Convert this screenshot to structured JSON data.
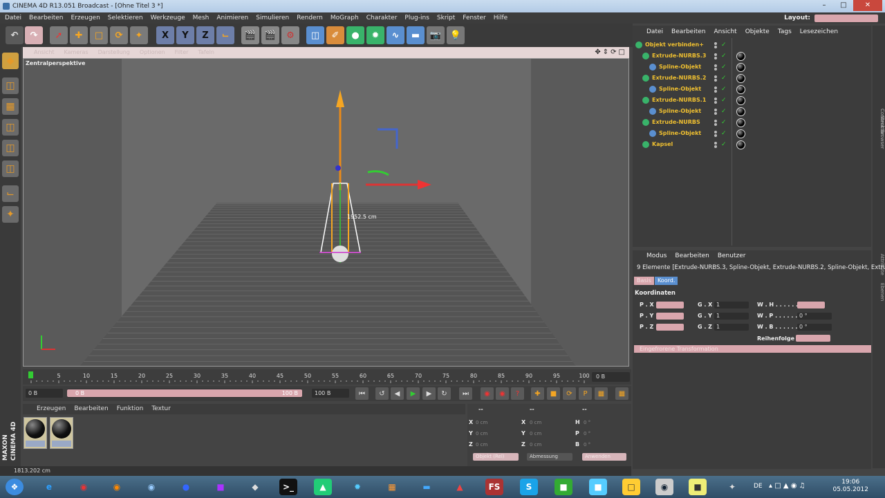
{
  "window": {
    "title": "CINEMA 4D R13.051 Broadcast - [Ohne Titel 3 *]"
  },
  "menubar": [
    "Datei",
    "Bearbeiten",
    "Erzeugen",
    "Selektieren",
    "Werkzeuge",
    "Mesh",
    "Animieren",
    "Simulieren",
    "Rendern",
    "MoGraph",
    "Charakter",
    "Plug-ins",
    "Skript",
    "Fenster",
    "Hilfe"
  ],
  "layout": {
    "label": "Layout:"
  },
  "viewport": {
    "menu": [
      "Ansicht",
      "Kameras",
      "Darstellung",
      "Optionen",
      "Filter",
      "Tafeln"
    ],
    "label": "Zentralperspektive",
    "measure": "1952.5 cm"
  },
  "timeline": {
    "ticks": [
      "0",
      "5",
      "10",
      "15",
      "20",
      "25",
      "30",
      "35",
      "40",
      "45",
      "50",
      "55",
      "60",
      "65",
      "70",
      "75",
      "80",
      "85",
      "90",
      "95",
      "100"
    ],
    "end_field": "0 B"
  },
  "transport": {
    "start": "0 B",
    "range_start": "0 B",
    "range_end": "100 B",
    "end": "100 B"
  },
  "material_manager": {
    "menu": [
      "Erzeugen",
      "Bearbeiten",
      "Funktion",
      "Textur"
    ]
  },
  "coordinates": {
    "headers": [
      "--",
      "--",
      "--"
    ],
    "rows": [
      {
        "a": "X",
        "av": "0 cm",
        "b": "X",
        "bv": "0 cm",
        "c": "H",
        "cv": "0 °"
      },
      {
        "a": "Y",
        "av": "0 cm",
        "b": "Y",
        "bv": "0 cm",
        "c": "P",
        "cv": "0 °"
      },
      {
        "a": "Z",
        "av": "0 cm",
        "b": "Z",
        "bv": "0 cm",
        "c": "B",
        "cv": "0 °"
      }
    ],
    "btn1": "Objekt (Rel)",
    "btn2": "Abmessung",
    "btn3": "Anwenden"
  },
  "object_manager": {
    "menu": [
      "Datei",
      "Bearbeiten",
      "Ansicht",
      "Objekte",
      "Tags",
      "Lesezeichen"
    ],
    "items": [
      {
        "name": "Objekt verbinden+",
        "indent": 0
      },
      {
        "name": "Extrude-NURBS.3",
        "indent": 1
      },
      {
        "name": "Spline-Objekt",
        "indent": 2
      },
      {
        "name": "Extrude-NURBS.2",
        "indent": 1
      },
      {
        "name": "Spline-Objekt",
        "indent": 2
      },
      {
        "name": "Extrude-NURBS.1",
        "indent": 1
      },
      {
        "name": "Spline-Objekt",
        "indent": 2
      },
      {
        "name": "Extrude-NURBS",
        "indent": 1
      },
      {
        "name": "Spline-Objekt",
        "indent": 2
      },
      {
        "name": "Kapsel",
        "indent": 1
      }
    ]
  },
  "side_tabs": [
    "Content Browser",
    "Struktur",
    "Attribute",
    "Ebenen"
  ],
  "attributes": {
    "menu": [
      "Modus",
      "Bearbeiten",
      "Benutzer"
    ],
    "title": "9 Elemente [Extrude-NURBS.3, Spline-Objekt, Extrude-NURBS.2, Spline-Objekt, Extrude-NURBS.1",
    "tab_basis": "Basis",
    "tab_koord": "Koord.",
    "section": "Koordinaten",
    "px": "P . X",
    "py": "P . Y",
    "pz": "P . Z",
    "gx": "G . X",
    "gy": "G . Y",
    "gz": "G . Z",
    "gxv": "1",
    "gyv": "1",
    "gzv": "1",
    "wh": "W . H . . . . . .",
    "wp": "W . P . . . . . .",
    "wb": "W . B . . . . . .",
    "wpv": "0 °",
    "wbv": "0 °",
    "order_label": "Reihenfolge",
    "frozen": "Eingefrorene Transformation"
  },
  "status": {
    "text": "1813.202 cm"
  },
  "taskbar": {
    "lang": "DE",
    "time": "19:06",
    "date": "05.05.2012"
  },
  "colors": {
    "accent_pink": "#d9a6ad",
    "object_name": "#f0c030",
    "taskbar": "#2f4d66"
  }
}
